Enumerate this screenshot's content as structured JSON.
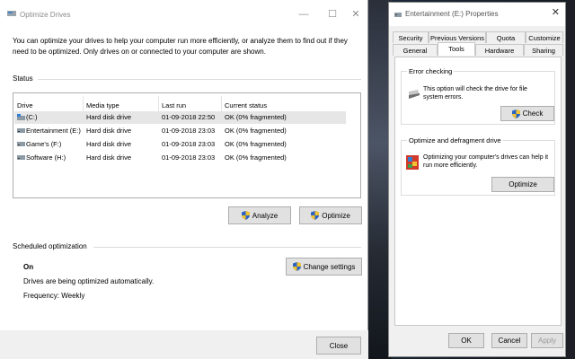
{
  "optimize_window": {
    "title": "Optimize Drives",
    "controls": {
      "minimize": "—",
      "maximize": "☐",
      "close": "✕"
    },
    "intro": "You can optimize your drives to help your computer run more efficiently, or analyze them to find out if they need to be optimized. Only drives on or connected to your computer are shown.",
    "status_label": "Status",
    "columns": {
      "drive": "Drive",
      "media_type": "Media type",
      "last_run": "Last run",
      "current_status": "Current status"
    },
    "drives": [
      {
        "name": "(C:)",
        "media_type": "Hard disk drive",
        "last_run": "01-09-2018 22:50",
        "status": "OK (0% fragmented)",
        "icon": "windows-drive-icon"
      },
      {
        "name": "Entertainment (E:)",
        "media_type": "Hard disk drive",
        "last_run": "01-09-2018 23:03",
        "status": "OK (0% fragmented)",
        "icon": "drive-icon"
      },
      {
        "name": "Game's (F:)",
        "media_type": "Hard disk drive",
        "last_run": "01-09-2018 23:03",
        "status": "OK (0% fragmented)",
        "icon": "drive-icon"
      },
      {
        "name": "Software (H:)",
        "media_type": "Hard disk drive",
        "last_run": "01-09-2018 23:03",
        "status": "OK (0% fragmented)",
        "icon": "drive-icon"
      }
    ],
    "analyze_label": "Analyze",
    "optimize_label": "Optimize",
    "scheduled_label": "Scheduled optimization",
    "schedule_state": "On",
    "change_settings_label": "Change settings",
    "schedule_desc": "Drives are being optimized automatically.",
    "frequency": "Frequency: Weekly",
    "close_label": "Close"
  },
  "properties_window": {
    "title": "Entertainment (E:) Properties",
    "close": "✕",
    "tabs_row1": [
      "Security",
      "Previous Versions",
      "Quota",
      "Customize"
    ],
    "tabs_row2": [
      "General",
      "Tools",
      "Hardware",
      "Sharing"
    ],
    "active_tab": "Tools",
    "error_group_label": "Error checking",
    "error_text": "This option will check the drive for file system errors.",
    "check_label": "Check",
    "optimize_group_label": "Optimize and defragment drive",
    "optimize_text": "Optimizing your computer's drives can help it run more efficiently.",
    "optimize_label": "Optimize",
    "ok_label": "OK",
    "cancel_label": "Cancel",
    "apply_label": "Apply"
  },
  "colors": {
    "selection": "#e6e6e6",
    "button_face": "#e1e1e1",
    "border": "#adadad",
    "shield_blue": "#2a64c4",
    "shield_yellow": "#f2c230"
  }
}
